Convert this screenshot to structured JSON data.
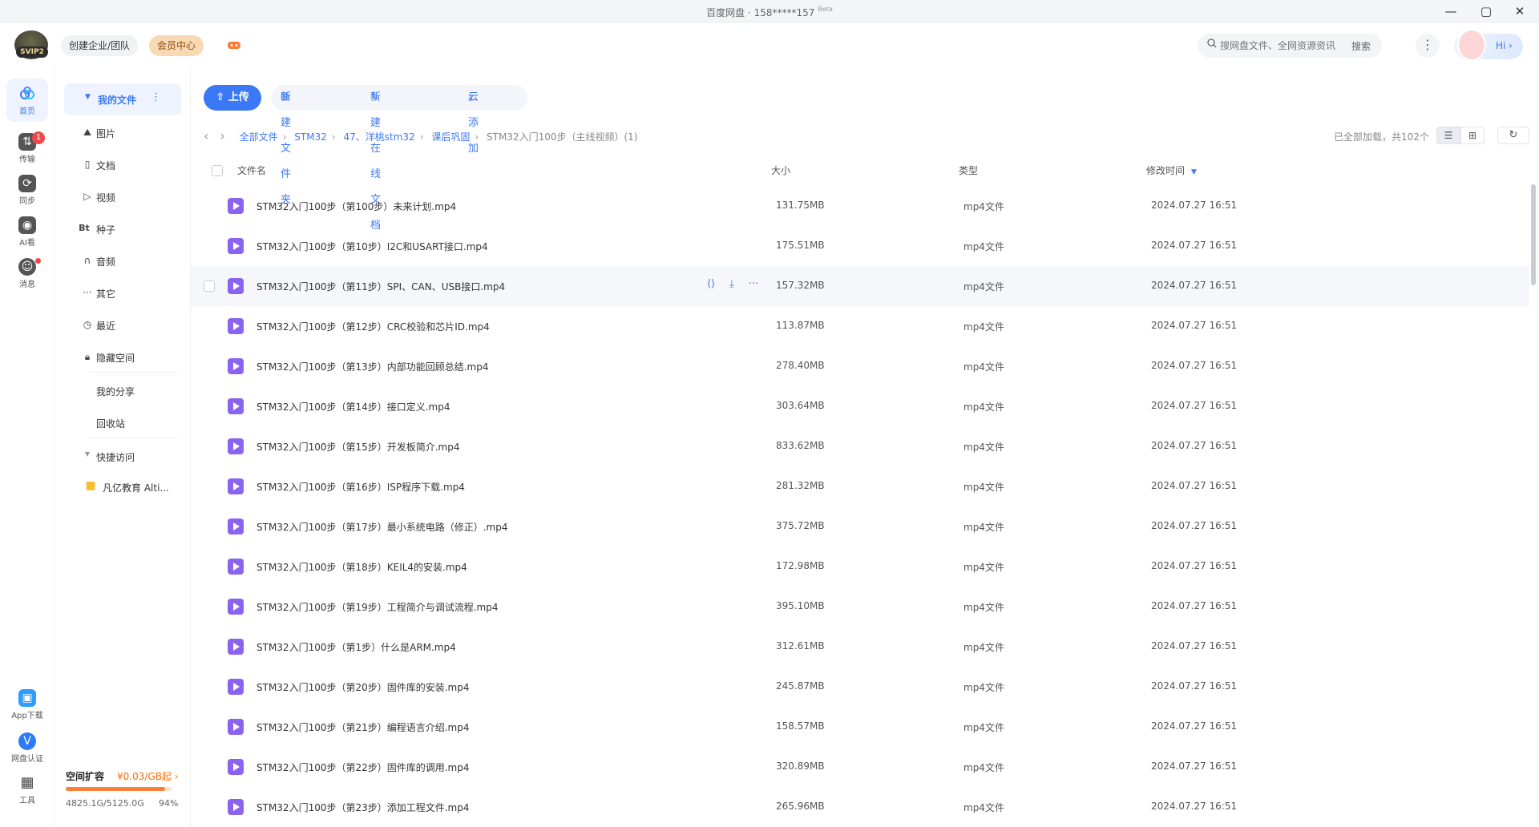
{
  "window": {
    "title": "百度网盘 · 158*****157",
    "beta": "Beta",
    "min_label": "—",
    "max_label": "▢",
    "close_label": "✕"
  },
  "topbar": {
    "svip_tag": "SVIP2",
    "team_button": "创建企业/团队",
    "vip_button": "会员中心",
    "search_placeholder": "搜网盘文件、全网资源资讯",
    "search_button": "搜索",
    "hi_text": "Hi ›"
  },
  "leftnav": {
    "items": [
      {
        "label": "首页"
      },
      {
        "label": "传输",
        "badge": "1"
      },
      {
        "label": "同步"
      },
      {
        "label": "AI看"
      },
      {
        "label": "消息"
      }
    ],
    "bottom": [
      {
        "label": "App下载"
      },
      {
        "label": "网盘认证"
      },
      {
        "label": "工具"
      }
    ]
  },
  "sidebar": {
    "my_files": "我的文件",
    "categories": [
      "图片",
      "文档",
      "视频",
      "种子",
      "音频",
      "其它",
      "最近",
      "隐藏空间"
    ],
    "seed_icon": "Bt",
    "my_share": "我的分享",
    "recycle": "回收站",
    "quick_access": "快捷访问",
    "quick_item": "凡亿教育 Alti...",
    "storage": {
      "expand_label": "空间扩容",
      "price": "¥0.03/GB起 ›",
      "used": "4825.1G/5125.0G",
      "percent": "94%",
      "used_fraction": 0.94
    }
  },
  "toolbar": {
    "upload": "上传",
    "new_folder": "新建文件夹",
    "new_doc": "新建在线文档",
    "cloud_add": "云添加"
  },
  "breadcrumb": {
    "items": [
      "全部文件",
      "STM32",
      "47、洋桃stm32",
      "课后巩固"
    ],
    "current": "STM32入门100步（主线视频）(1)",
    "loaded_text": "已全部加载，共102个"
  },
  "table": {
    "headers": {
      "name": "文件名",
      "size": "大小",
      "type": "类型",
      "time": "修改时间"
    },
    "rows": [
      {
        "name": "STM32入门100步（第100步）未来计划.mp4",
        "size": "131.75MB",
        "type": "mp4文件",
        "time": "2024.07.27 16:51"
      },
      {
        "name": "STM32入门100步（第10步）I2C和USART接口.mp4",
        "size": "175.51MB",
        "type": "mp4文件",
        "time": "2024.07.27 16:51"
      },
      {
        "name": "STM32入门100步（第11步）SPI、CAN、USB接口.mp4",
        "size": "157.32MB",
        "type": "mp4文件",
        "time": "2024.07.27 16:51"
      },
      {
        "name": "STM32入门100步（第12步）CRC校验和芯片ID.mp4",
        "size": "113.87MB",
        "type": "mp4文件",
        "time": "2024.07.27 16:51"
      },
      {
        "name": "STM32入门100步（第13步）内部功能回顾总结.mp4",
        "size": "278.40MB",
        "type": "mp4文件",
        "time": "2024.07.27 16:51"
      },
      {
        "name": "STM32入门100步（第14步）接口定义.mp4",
        "size": "303.64MB",
        "type": "mp4文件",
        "time": "2024.07.27 16:51"
      },
      {
        "name": "STM32入门100步（第15步）开发板简介.mp4",
        "size": "833.62MB",
        "type": "mp4文件",
        "time": "2024.07.27 16:51"
      },
      {
        "name": "STM32入门100步（第16步）ISP程序下载.mp4",
        "size": "281.32MB",
        "type": "mp4文件",
        "time": "2024.07.27 16:51"
      },
      {
        "name": "STM32入门100步（第17步）最小系统电路（修正）.mp4",
        "size": "375.72MB",
        "type": "mp4文件",
        "time": "2024.07.27 16:51"
      },
      {
        "name": "STM32入门100步（第18步）KEIL4的安装.mp4",
        "size": "172.98MB",
        "type": "mp4文件",
        "time": "2024.07.27 16:51"
      },
      {
        "name": "STM32入门100步（第19步）工程简介与调试流程.mp4",
        "size": "395.10MB",
        "type": "mp4文件",
        "time": "2024.07.27 16:51"
      },
      {
        "name": "STM32入门100步（第1步）什么是ARM.mp4",
        "size": "312.61MB",
        "type": "mp4文件",
        "time": "2024.07.27 16:51"
      },
      {
        "name": "STM32入门100步（第20步）固件库的安装.mp4",
        "size": "245.87MB",
        "type": "mp4文件",
        "time": "2024.07.27 16:51"
      },
      {
        "name": "STM32入门100步（第21步）编程语言介绍.mp4",
        "size": "158.57MB",
        "type": "mp4文件",
        "time": "2024.07.27 16:51"
      },
      {
        "name": "STM32入门100步（第22步）固件库的调用.mp4",
        "size": "320.89MB",
        "type": "mp4文件",
        "time": "2024.07.27 16:51"
      },
      {
        "name": "STM32入门100步（第23步）添加工程文件.mp4",
        "size": "265.96MB",
        "type": "mp4文件",
        "time": "2024.07.27 16:51"
      }
    ]
  },
  "colors": {
    "accent": "#3b78f5",
    "video": "#8a64f0",
    "vip": "#f9d9b4",
    "storage": "#ff7f39"
  },
  "icons": [
    "home-icon",
    "transfer-icon",
    "sync-icon",
    "ai-icon",
    "message-icon",
    "app-download-icon",
    "verify-icon",
    "tools-icon",
    "share-icon",
    "download-icon",
    "more-icon",
    "search-icon",
    "refresh-icon"
  ]
}
